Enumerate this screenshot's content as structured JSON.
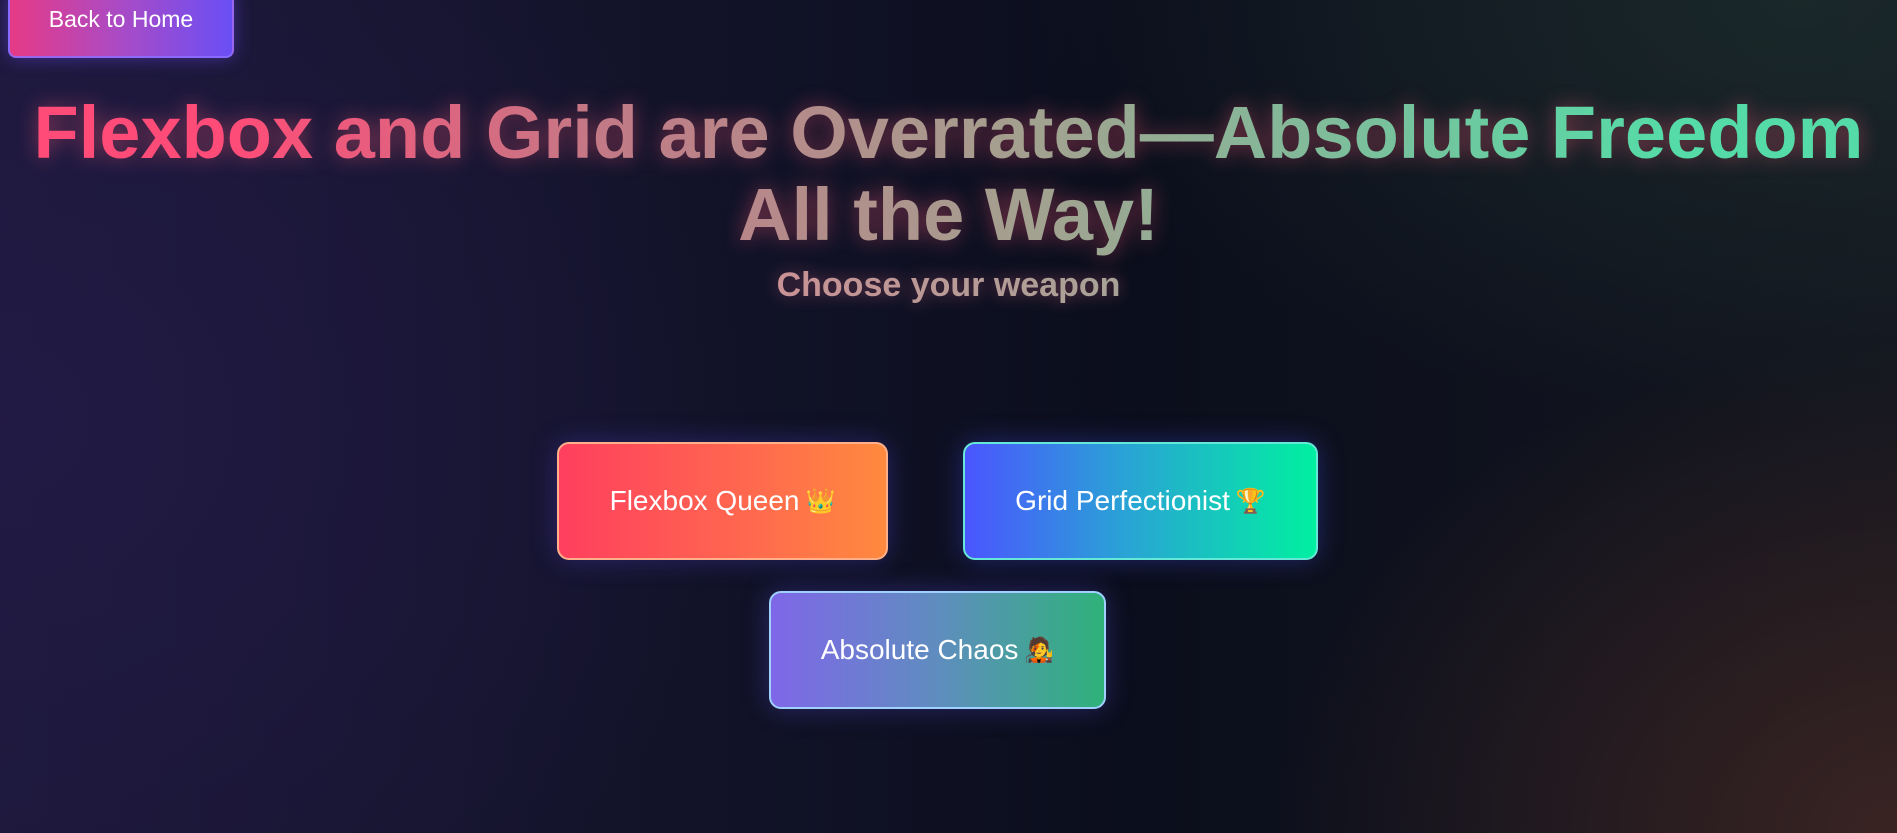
{
  "nav": {
    "back_label": "Back to Home"
  },
  "header": {
    "title": "Flexbox and Grid are Overrated—Absolute Freedom All the Way!",
    "subtitle": "Choose your weapon"
  },
  "choices": [
    {
      "label": "Flexbox Queen",
      "emoji": "👑",
      "icon": "crown-icon"
    },
    {
      "label": "Grid Perfectionist",
      "emoji": "🏆",
      "icon": "trophy-icon"
    },
    {
      "label": "Absolute Chaos",
      "emoji": "🧑‍🎤",
      "icon": "chaos-person-icon"
    }
  ],
  "colors": {
    "back_button_gradient": [
      "#e63a86",
      "#6a4ff5"
    ],
    "flexbox_gradient": [
      "#ff3f5e",
      "#ff8a3e"
    ],
    "grid_gradient": [
      "#4b55ff",
      "#00f0a0"
    ],
    "chaos_gradient": [
      "#7f67e8",
      "#2fb27a"
    ],
    "title_gradient": [
      "#ff4b78",
      "#55dba7"
    ]
  }
}
